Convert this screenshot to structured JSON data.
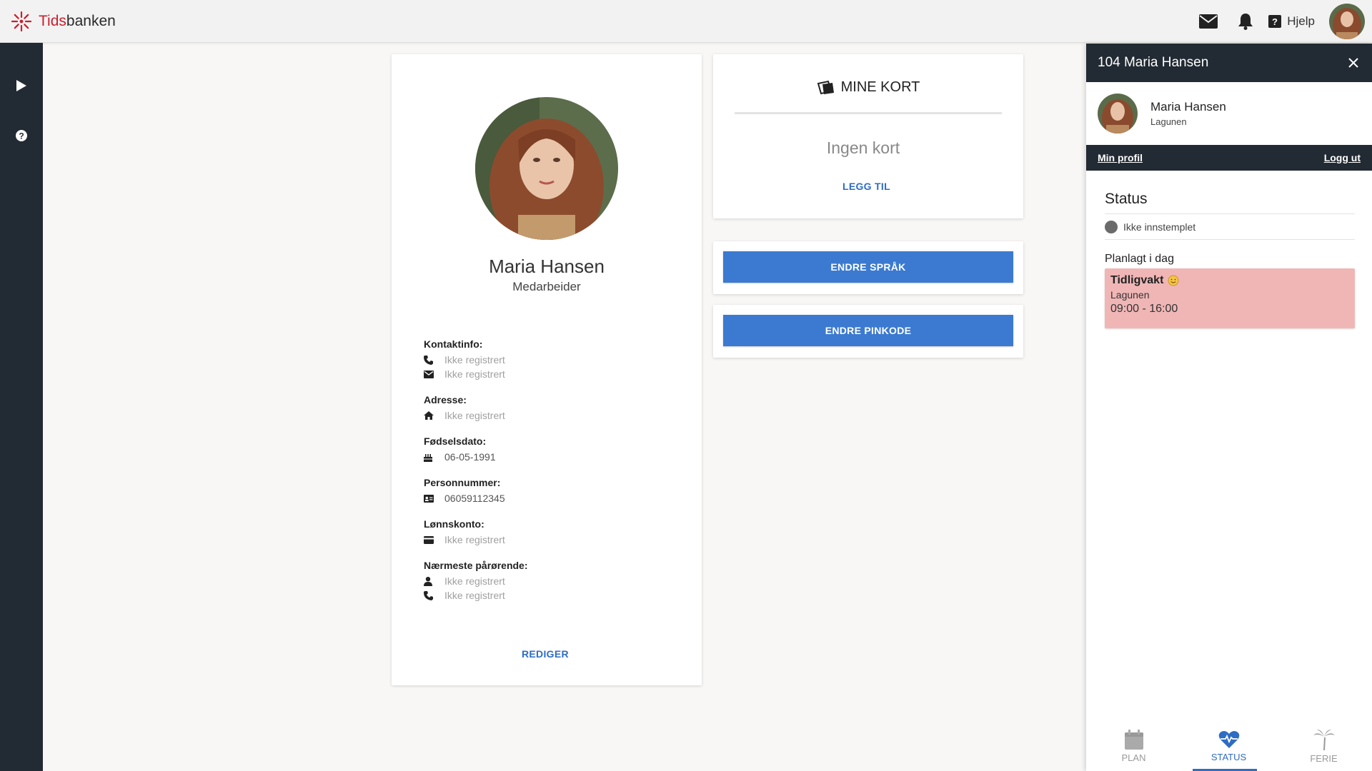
{
  "app": {
    "logo_red": "Tids",
    "logo_dark": "banken",
    "help_label": "Hjelp"
  },
  "colors": {
    "sidebar": "#222a33",
    "accent": "#3b7ad0",
    "shift": "#f0b6b6",
    "logo_red": "#c8202f"
  },
  "profile": {
    "name": "Maria Hansen",
    "role": "Medarbeider",
    "contact_label": "Kontaktinfo:",
    "phone": "Ikke registrert",
    "email": "Ikke registrert",
    "address_label": "Adresse:",
    "address": "Ikke registrert",
    "birth_label": "Fødselsdato:",
    "birth": "06-05-1991",
    "ssn_label": "Personnummer:",
    "ssn": "06059112345",
    "account_label": "Lønnskonto:",
    "account": "Ikke registrert",
    "relative_label": "Nærmeste pårørende:",
    "relative_name": "Ikke registrert",
    "relative_phone": "Ikke registrert",
    "edit_link": "REDIGER"
  },
  "cards": {
    "title": "MINE KORT",
    "empty": "Ingen kort",
    "add_link": "LEGG TIL"
  },
  "buttons": {
    "change_language": "ENDRE SPRÅK",
    "change_pin": "ENDRE PINKODE"
  },
  "panel": {
    "title": "104 Maria Hansen",
    "user_name": "Maria Hansen",
    "user_location": "Lagunen",
    "my_profile": "Min profil",
    "logout": "Logg ut",
    "status_title": "Status",
    "status_value": "Ikke innstemplet",
    "planned_title": "Planlagt i dag",
    "shift_name": "Tidligvakt",
    "shift_location": "Lagunen",
    "shift_time": "09:00 - 16:00"
  },
  "bottom_nav": {
    "plan": "PLAN",
    "status": "STATUS",
    "ferie": "FERIE",
    "active": "STATUS"
  }
}
